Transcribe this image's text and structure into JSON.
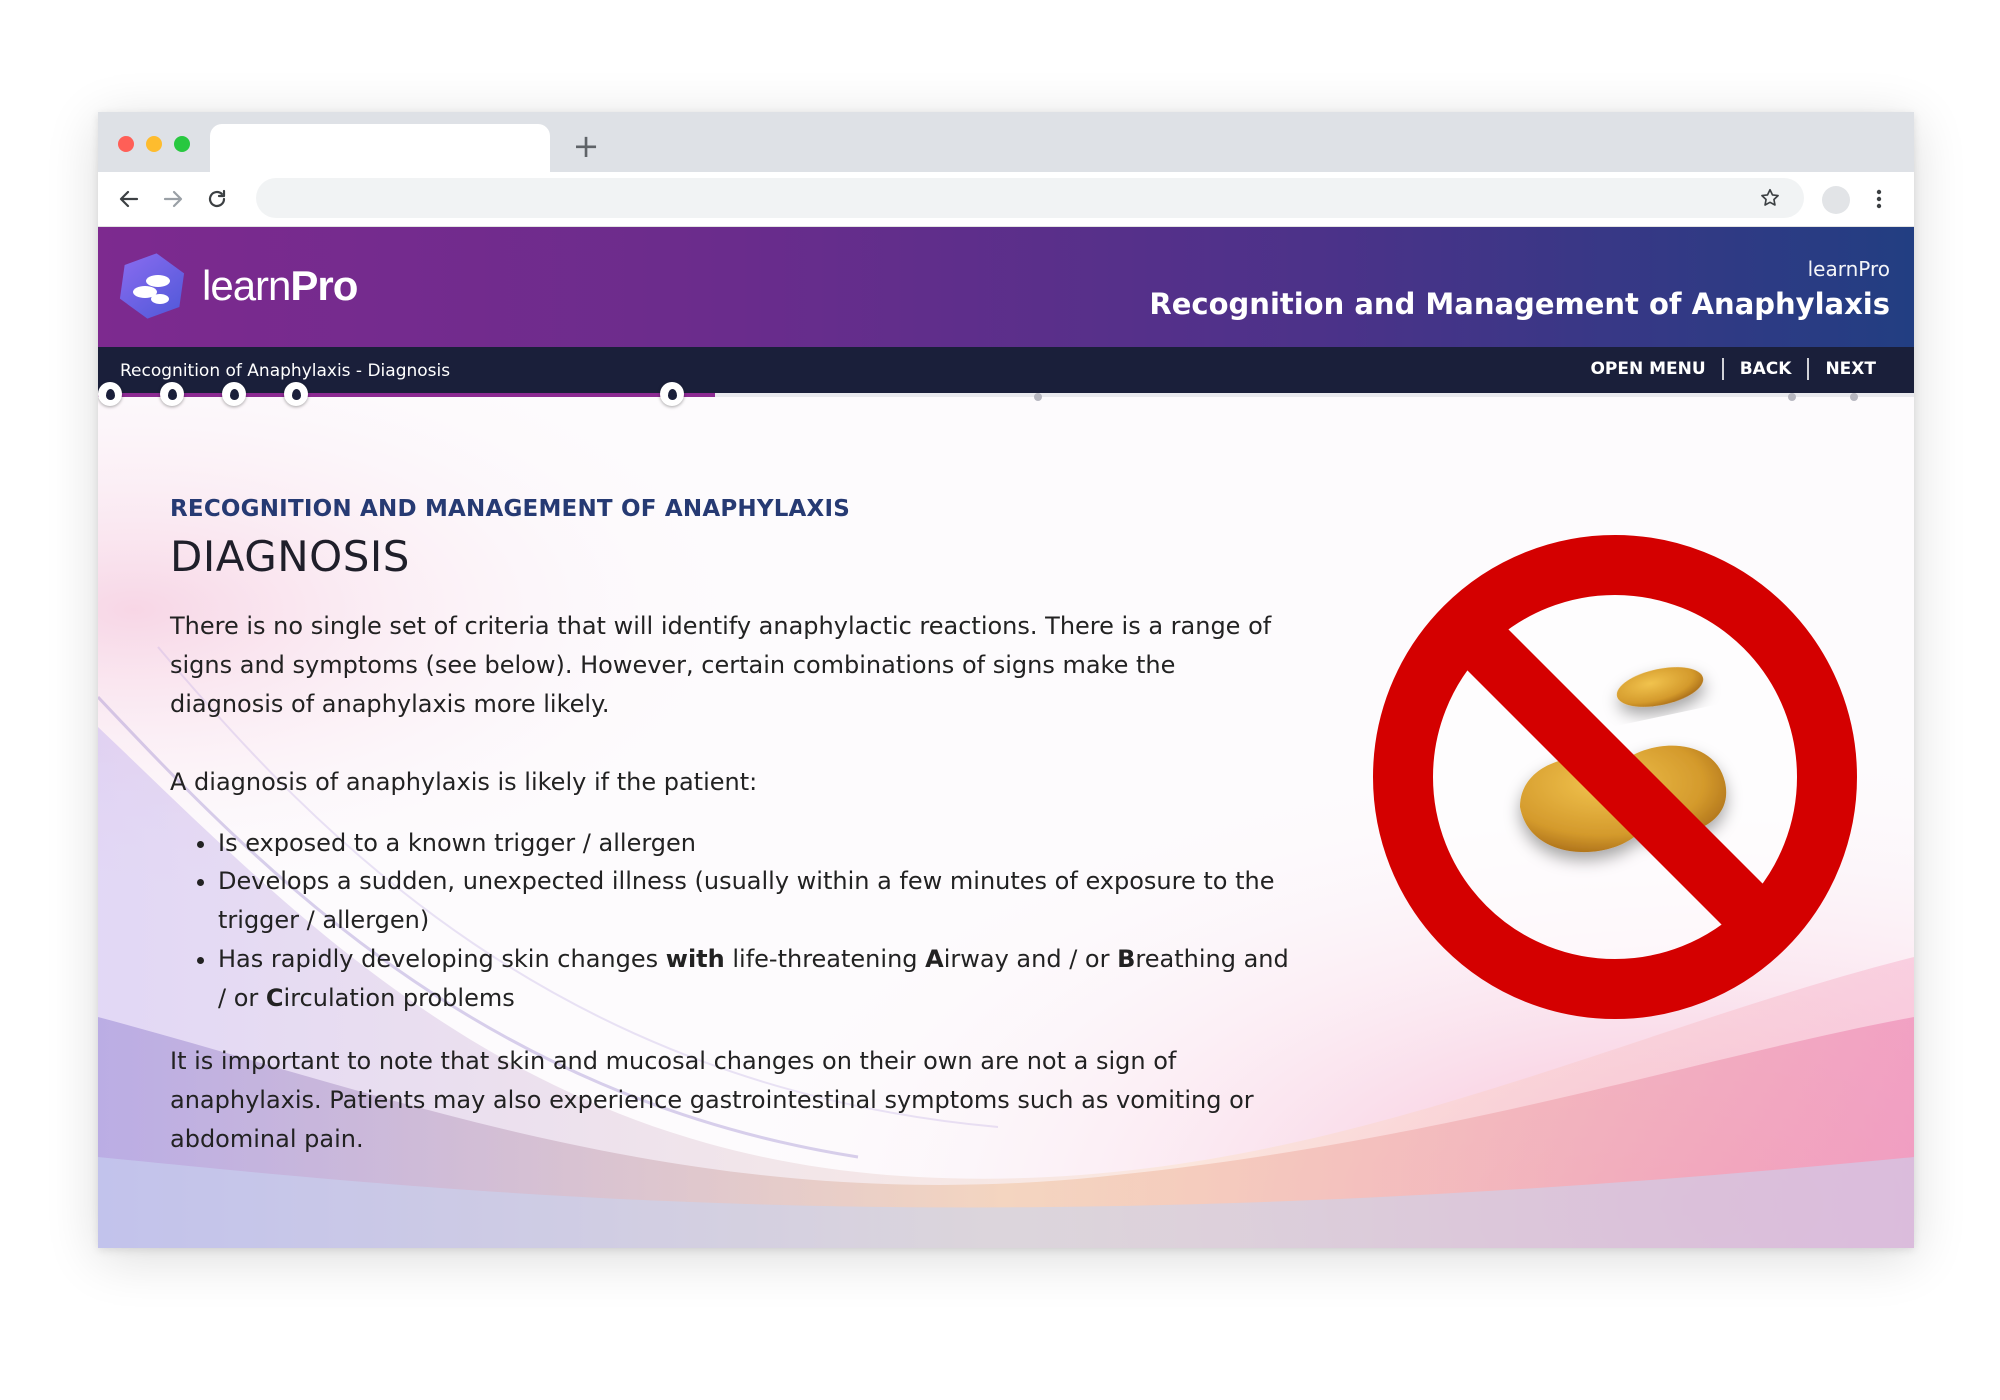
{
  "browser": {
    "new_tab_label": "+"
  },
  "header": {
    "logo_text_light": "learn",
    "logo_text_bold": "Pro",
    "brand_small": "learnPro",
    "course_title": "Recognition and Management of Anaphylaxis"
  },
  "nav": {
    "section_title": "Recognition of Anaphylaxis - Diagnosis",
    "open_menu": "OPEN MENU",
    "back": "BACK",
    "next": "NEXT"
  },
  "progress": {
    "fill_fraction": 0.34
  },
  "content": {
    "kicker": "RECOGNITION AND MANAGEMENT OF ANAPHYLAXIS",
    "title": "DIAGNOSIS",
    "paragraph1": "There is no single set of criteria that will identify anaphylactic reactions. There is a range of signs and symptoms (see below). However, certain combinations of signs make the diagnosis of anaphylaxis more likely.",
    "paragraph2": "A diagnosis of anaphylaxis is likely if the patient:",
    "bullet1": "Is exposed to a known trigger / allergen",
    "bullet2": "Develops a sudden, unexpected illness (usually within a few minutes of exposure to the trigger / allergen)",
    "bullet3": {
      "part1": "Has rapidly developing skin changes ",
      "bold_with": "with",
      "part2": " life-threatening ",
      "bold_a": "A",
      "part3": "irway and / or ",
      "bold_b": "B",
      "part4": "reathing and / or ",
      "bold_c": "C",
      "part5": "irculation problems"
    },
    "paragraph3": "It is important to note that skin and mucosal changes on their own are not a sign of anaphylaxis. Patients may also experience gastrointestinal symptoms such as vomiting or abdominal pain."
  },
  "colors": {
    "header_start": "#7d2a8f",
    "header_end": "#223e82",
    "navbar": "#1a1f3a",
    "progress": "#8c2a92",
    "kicker": "#263a73",
    "no_sign": "#d40000"
  },
  "icons": {
    "logo": "learnpro-logo-icon",
    "back": "arrow-left-icon",
    "forward": "arrow-right-icon",
    "reload": "reload-icon",
    "bookmark": "star-icon",
    "menu": "kebab-menu-icon",
    "image": "no-peanuts-icon"
  }
}
